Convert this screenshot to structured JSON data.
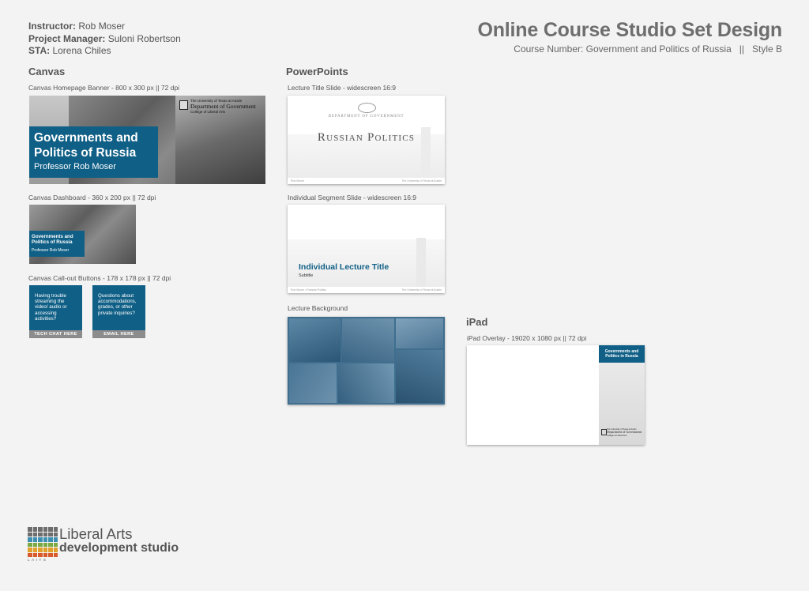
{
  "meta": {
    "instructor_label": "Instructor:",
    "instructor": "Rob Moser",
    "pm_label": "Project Manager:",
    "pm": "Suloni Robertson",
    "sta_label": "STA:",
    "sta": "Lorena Chiles"
  },
  "header": {
    "title": "Online Course Studio Set Design",
    "subtitle": "Course Number: Government and Politics of Russia   ||   Style B"
  },
  "canvas": {
    "heading": "Canvas",
    "banner_caption": "Canvas Homepage Banner - 800 x 300 px || 72 dpi",
    "banner_title_1": "Governments and",
    "banner_title_2": "Politics of Russia",
    "banner_professor": "Professor Rob Moser",
    "banner_univ": "The University of Texas at Austin",
    "banner_dept": "Department of Government",
    "banner_college": "College of Liberal Arts",
    "dashboard_caption": "Canvas Dashboard - 360 x 200 px || 72 dpi",
    "dash_title_1": "Governments and",
    "dash_title_2": "Politics of Russia",
    "dash_professor": "Professor Rob Moser",
    "callout_caption": "Canvas Call-out Buttons - 178 x 178 px || 72 dpi",
    "callout1_text": "Having trouble streaming the video/ audio or accessing activities?",
    "callout1_button": "TECH CHAT HERE",
    "callout2_text": "Questions about accommodations, grades, or other private inquiries?",
    "callout2_button": "EMAIL HERE"
  },
  "powerpoints": {
    "heading": "PowerPoints",
    "title_slide_caption": "Lecture Title Slide - widescreen 16:9",
    "title_slide_dept": "DEPARTMENT OF GOVERNMENT",
    "title_slide_title": "Russian Politics",
    "title_slide_foot_left": "Rob Moser",
    "title_slide_foot_right": "The University of Texas at Austin",
    "segment_caption": "Individual Segment Slide - widescreen 16:9",
    "segment_title": "Individual Lecture Title",
    "segment_subtitle": "Subtitle",
    "segment_foot_left": "Rob Moser • Russian Politics",
    "segment_foot_right": "The University of Texas at Austin",
    "background_caption": "Lecture Background"
  },
  "ipad": {
    "heading": "iPad",
    "caption": "iPad Overlay - 19020 x 1080 px || 72 dpi",
    "panel_title_1": "Governments and",
    "panel_title_2": "Politics in Russia",
    "panel_univ": "The University of Texas at Austin",
    "panel_dept": "Department of Government",
    "panel_college": "College of Liberal Arts"
  },
  "logo": {
    "line1": "Liberal Arts",
    "line2": "development studio",
    "small": "LAITS",
    "colors": [
      "#6d6d6d",
      "#3d8fb2",
      "#7aa944",
      "#e0a02a",
      "#d85a2a",
      "#8a8a8a"
    ]
  }
}
